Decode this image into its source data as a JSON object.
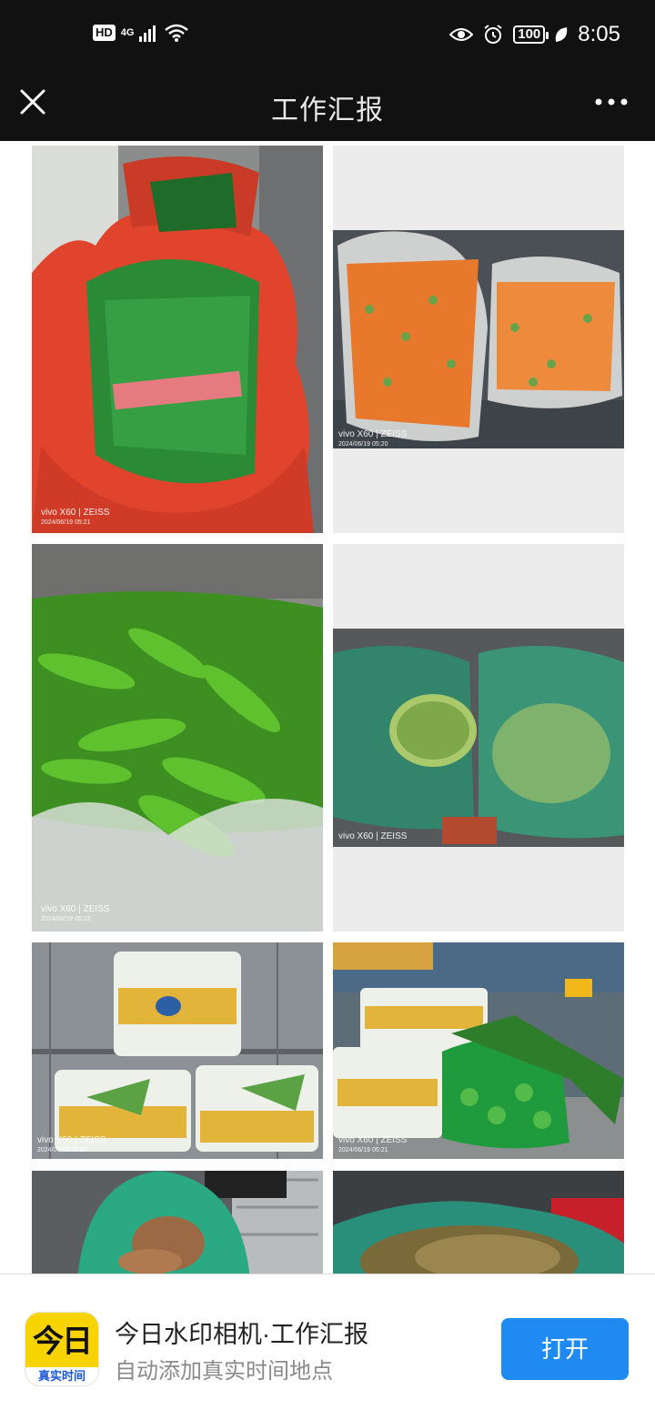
{
  "status": {
    "hd": "HD",
    "network": "4G",
    "battery": "100",
    "time": "8:05"
  },
  "nav": {
    "title": "工作汇报"
  },
  "photos": [
    {
      "name": "photo-chives",
      "camera": "vivo X60 | ZEISS",
      "date": "2024/06/19 05:21"
    },
    {
      "name": "photo-carrots",
      "camera": "vivo X60 | ZEISS",
      "date": "2024/06/19 05:20"
    },
    {
      "name": "photo-green-peppers",
      "camera": "vivo X60 | ZEISS",
      "date": "2024/06/19 05:22"
    },
    {
      "name": "photo-cabbage",
      "camera": "vivo X60 | ZEISS",
      "date": ""
    },
    {
      "name": "photo-packaged-vegetables",
      "camera": "vivo X60 | ZEISS",
      "date": "2024/06/19 05:22"
    },
    {
      "name": "photo-mixed-vegetables",
      "camera": "vivo X60 | ZEISS",
      "date": "2024/06/19 05:21"
    },
    {
      "name": "photo-yams",
      "camera": "",
      "date": ""
    },
    {
      "name": "photo-potatoes",
      "camera": "",
      "date": ""
    }
  ],
  "banner": {
    "icon_big": "今日",
    "icon_label": "真实时间",
    "title": "今日水印相机·工作汇报",
    "subtitle": "自动添加真实时间地点",
    "open_label": "打开"
  },
  "colors": {
    "top_bar": "#111111",
    "open_button": "#1e8af2",
    "icon_yellow": "#f7d400"
  }
}
